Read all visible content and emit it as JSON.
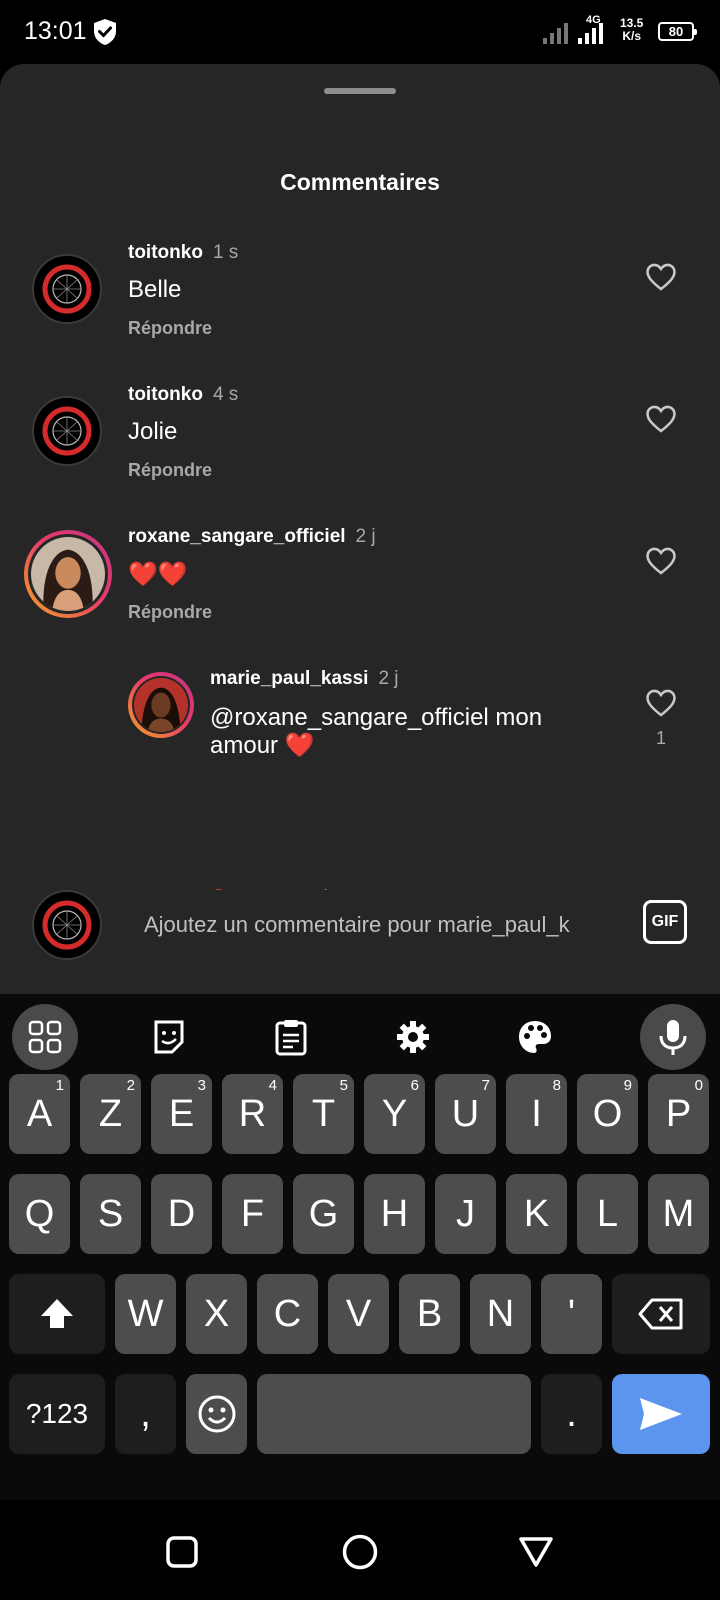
{
  "status_bar": {
    "time": "13:01",
    "network": "4G",
    "speed_value": "13.5",
    "speed_unit": "K/s",
    "battery": "80"
  },
  "sheet": {
    "title": "Commentaires"
  },
  "comments": [
    {
      "username": "toitonko",
      "time": "1 s",
      "text": "Belle",
      "reply": "Répondre"
    },
    {
      "username": "toitonko",
      "time": "4 s",
      "text": "Jolie",
      "reply": "Répondre"
    },
    {
      "username": "roxane_sangare_officiel",
      "time": "2 j",
      "text": "❤️❤️",
      "reply": "Répondre"
    },
    {
      "username": "marie_paul_kassi",
      "time": "2 j",
      "text_line1": "@roxane_sangare_officiel mon",
      "text_line2": "amour ❤️",
      "likes": "1"
    }
  ],
  "quick_reactions": [
    "❤️",
    "🙌",
    "🔥",
    "👏",
    "😢",
    "😍",
    "😮",
    "😂"
  ],
  "composer": {
    "placeholder": "Ajoutez un commentaire pour marie_paul_k",
    "gif_label": "GIF"
  },
  "keyboard": {
    "row1": [
      {
        "key": "A",
        "hint": "1"
      },
      {
        "key": "Z",
        "hint": "2"
      },
      {
        "key": "E",
        "hint": "3"
      },
      {
        "key": "R",
        "hint": "4"
      },
      {
        "key": "T",
        "hint": "5"
      },
      {
        "key": "Y",
        "hint": "6"
      },
      {
        "key": "U",
        "hint": "7"
      },
      {
        "key": "I",
        "hint": "8"
      },
      {
        "key": "O",
        "hint": "9"
      },
      {
        "key": "P",
        "hint": "0"
      }
    ],
    "row2": [
      "Q",
      "S",
      "D",
      "F",
      "G",
      "H",
      "J",
      "K",
      "L",
      "M"
    ],
    "row3": [
      "W",
      "X",
      "C",
      "V",
      "B",
      "N",
      "'"
    ],
    "symbols_label": "?123",
    "comma": ",",
    "period": "."
  },
  "colors": {
    "sheet_bg": "#262626",
    "send_key": "#5b95f0",
    "heart_red": "#e0242f"
  }
}
